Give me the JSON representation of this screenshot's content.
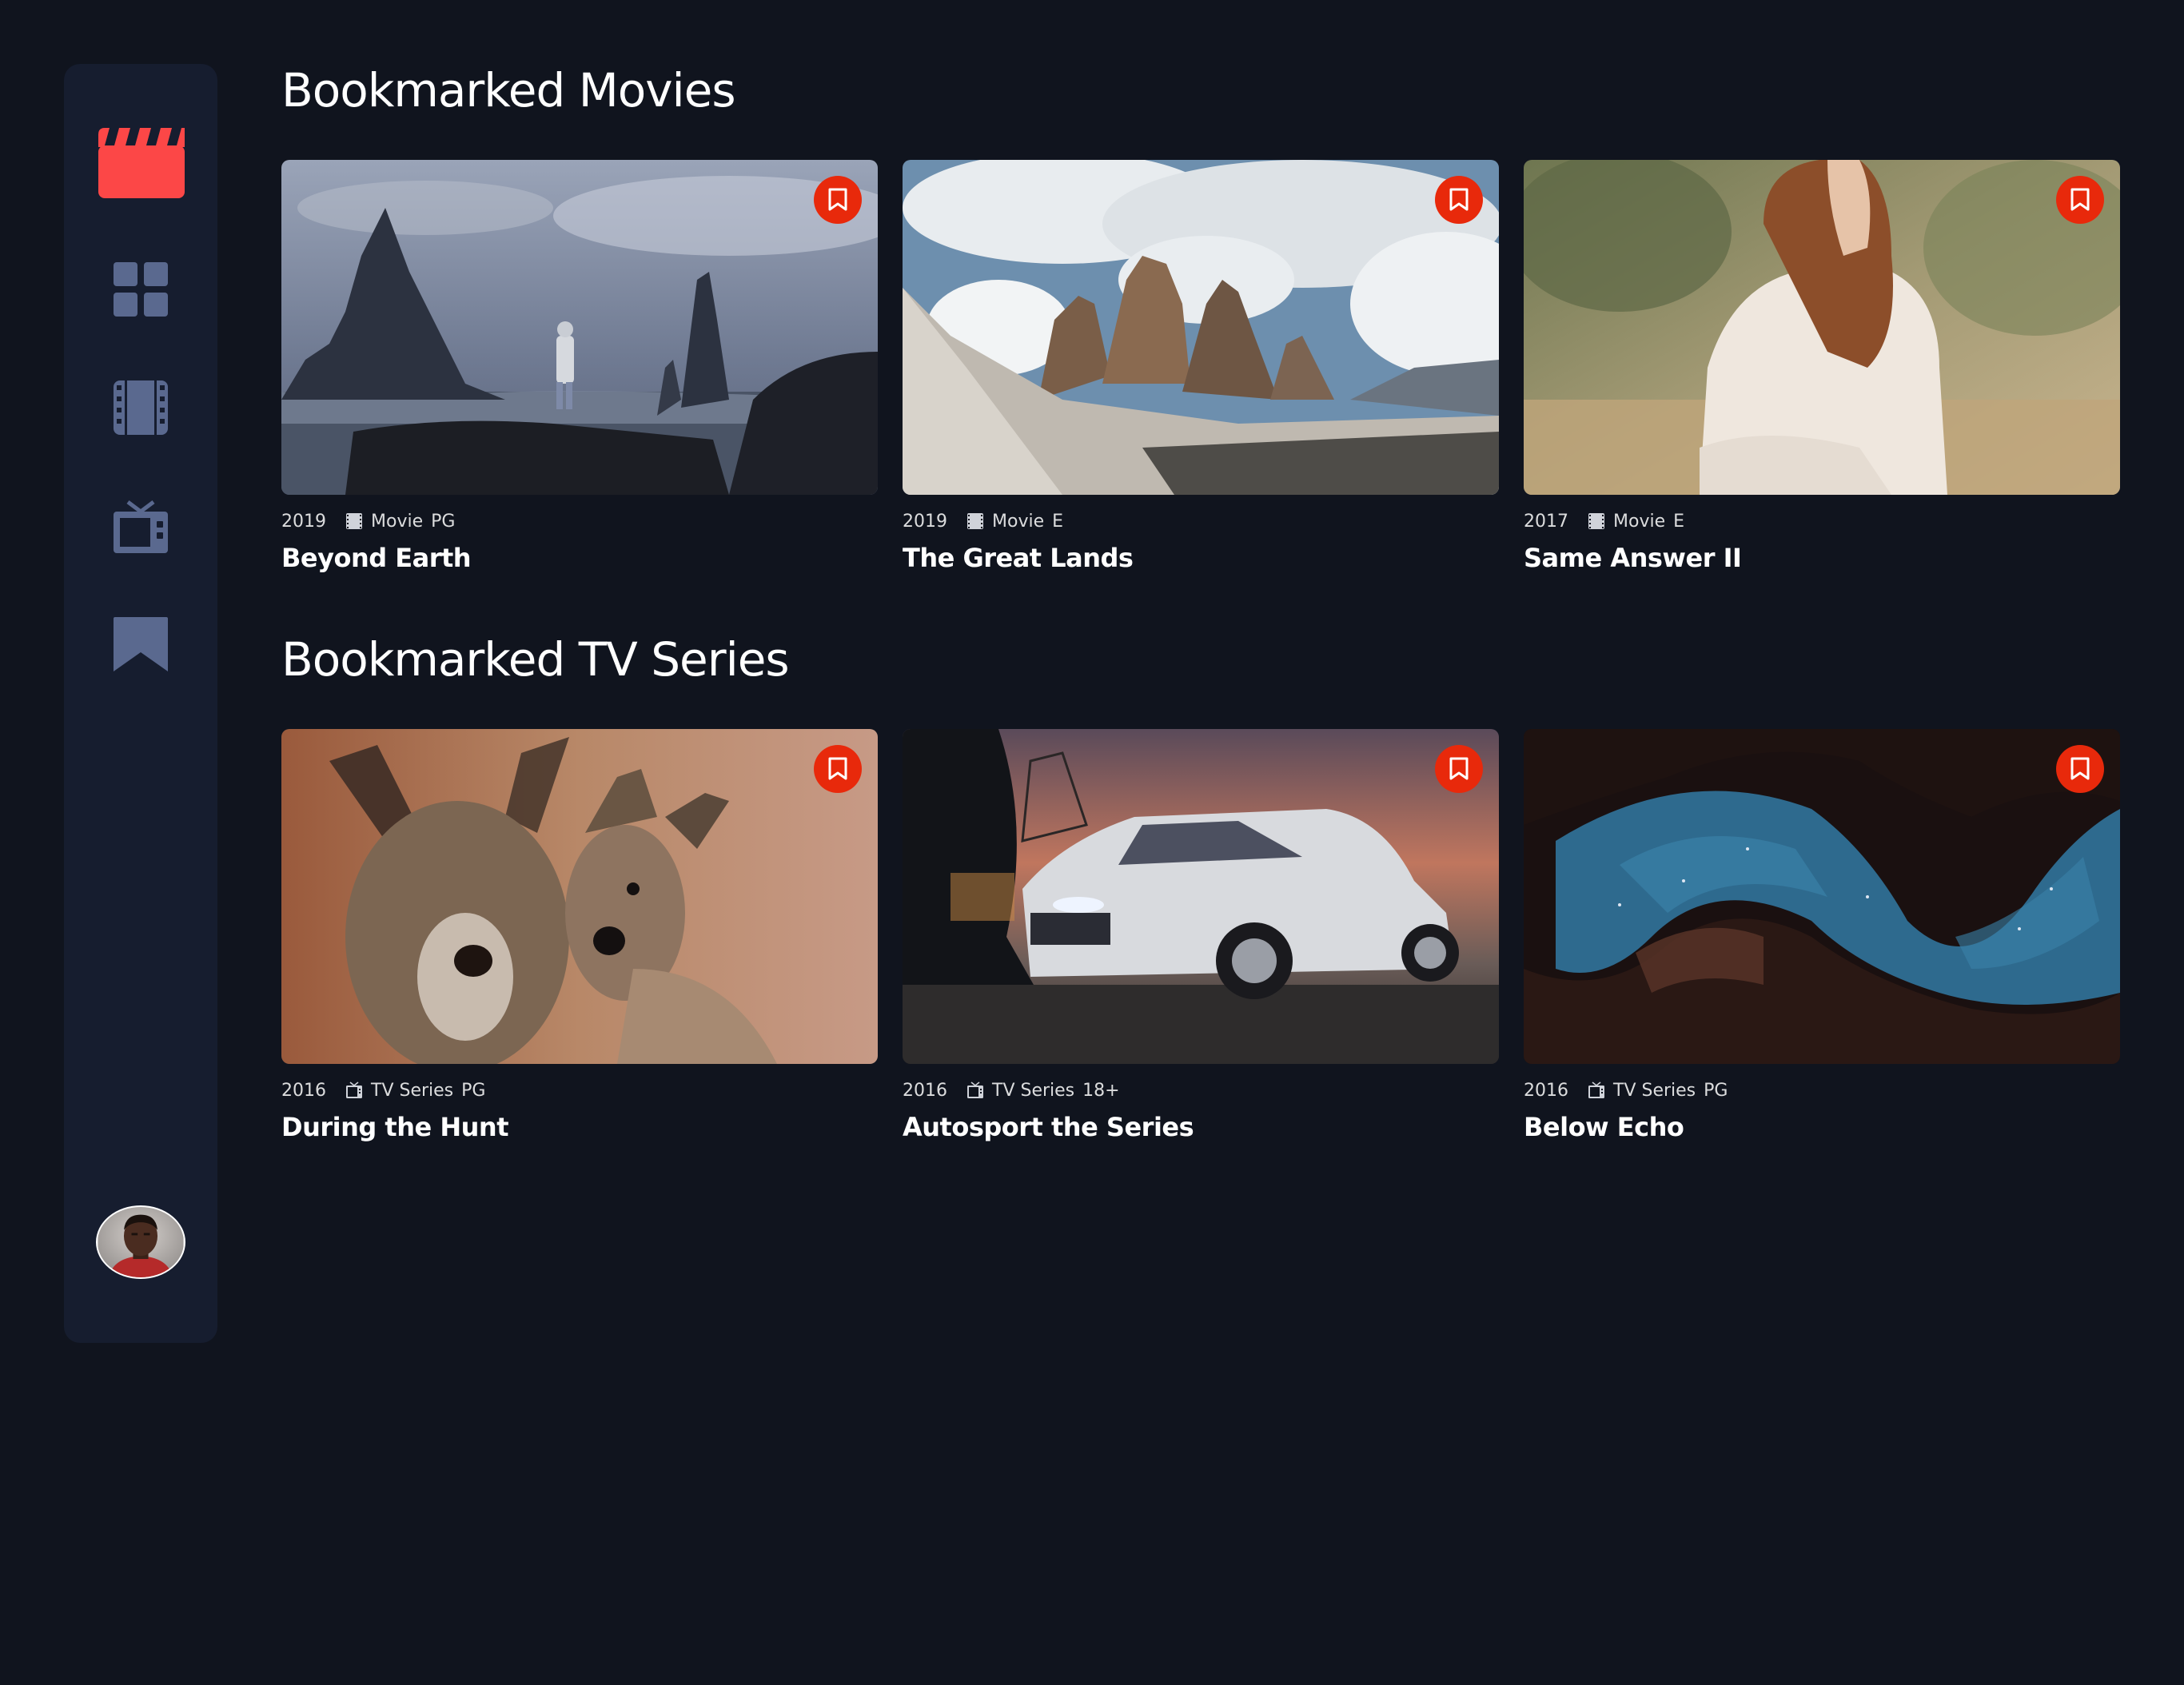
{
  "app": {
    "accent_color": "#FC4747",
    "bookmark_color": "#E8290B",
    "background_color": "#10141E",
    "sidebar_color": "#161D2F",
    "nav_icon_color": "#5A698F"
  },
  "sidebar": {
    "logo_icon": "clapperboard-icon",
    "nav": [
      {
        "name": "home",
        "icon": "grid-icon"
      },
      {
        "name": "movies",
        "icon": "film-icon"
      },
      {
        "name": "tv-series",
        "icon": "tv-icon"
      },
      {
        "name": "bookmarks",
        "icon": "bookmark-icon",
        "active": true
      }
    ],
    "avatar_icon": "user-avatar"
  },
  "sections": {
    "movies": {
      "title": "Bookmarked Movies",
      "items": [
        {
          "year": "2019",
          "category": "Movie",
          "rating": "PG",
          "title": "Beyond Earth",
          "category_icon": "film-icon"
        },
        {
          "year": "2019",
          "category": "Movie",
          "rating": "E",
          "title": "The Great Lands",
          "category_icon": "film-icon"
        },
        {
          "year": "2017",
          "category": "Movie",
          "rating": "E",
          "title": "Same Answer II",
          "category_icon": "film-icon"
        }
      ]
    },
    "tv": {
      "title": "Bookmarked TV Series",
      "items": [
        {
          "year": "2016",
          "category": "TV Series",
          "rating": "PG",
          "title": "During the Hunt",
          "category_icon": "tv-icon"
        },
        {
          "year": "2016",
          "category": "TV Series",
          "rating": "18+",
          "title": "Autosport the Series",
          "category_icon": "tv-icon"
        },
        {
          "year": "2016",
          "category": "TV Series",
          "rating": "PG",
          "title": "Below Echo",
          "category_icon": "tv-icon"
        }
      ]
    }
  }
}
